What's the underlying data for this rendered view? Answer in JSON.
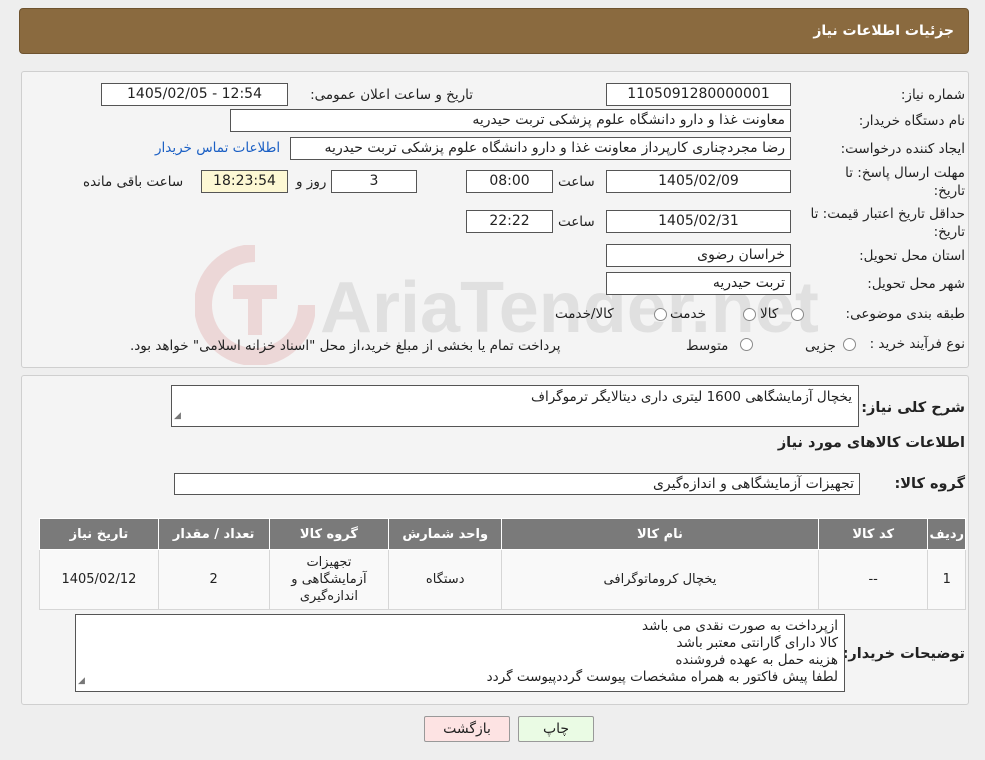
{
  "header": {
    "title": "جزئیات اطلاعات نیاز"
  },
  "watermark": {
    "text": "AriaTender.net"
  },
  "form": {
    "need_number_label": "شماره نیاز:",
    "need_number": "1105091280000001",
    "announce_label": "تاریخ و ساعت اعلان عمومی:",
    "announce_value": "1405/02/05 - 12:54",
    "buyer_org_label": "نام دستگاه خریدار:",
    "buyer_org": "معاونت غذا و دارو   دانشگاه علوم پزشکی تربت حیدریه",
    "creator_label": "ایجاد کننده درخواست:",
    "creator": "رضا مجردچناری کارپرداز معاونت غذا و دارو   دانشگاه علوم پزشکی تربت حیدریه",
    "contact_link": "اطلاعات تماس خریدار",
    "deadline_label_1": "مهلت ارسال پاسخ: تا",
    "deadline_label_2": "تاریخ:",
    "deadline_date": "1405/02/09",
    "time_label": "ساعت",
    "deadline_time": "08:00",
    "days_value": "3",
    "days_label": "روز و",
    "remaining_time": "18:23:54",
    "remaining_label": "ساعت باقی مانده",
    "validity_label_1": "حداقل تاریخ اعتبار قیمت: تا",
    "validity_label_2": "تاریخ:",
    "validity_date": "1405/02/31",
    "validity_time": "22:22",
    "province_label": "استان محل تحویل:",
    "province": "خراسان رضوی",
    "city_label": "شهر محل تحویل:",
    "city": "تربت حیدریه",
    "category_label": "طبقه بندی موضوعی:",
    "category_options": [
      "کالا",
      "خدمت",
      "کالا/خدمت"
    ],
    "process_label": "نوع فرآیند خرید :",
    "process_options": [
      "جزیی",
      "متوسط"
    ],
    "process_note": "پرداخت تمام یا بخشی از مبلغ خرید،از محل \"اسناد خزانه اسلامی\" خواهد بود."
  },
  "summary": {
    "label": "شرح کلی نیاز:",
    "value": "یخچال آزمایشگاهی 1600 لیتری داری دیتالایگر ترموگراف",
    "goods_info_title": "اطلاعات کالاهای مورد نیاز",
    "group_label": "گروه کالا:",
    "group_value": "تجهیزات آزمایشگاهی و اندازه‌گیری"
  },
  "table": {
    "headers": [
      "ردیف",
      "کد کالا",
      "نام کالا",
      "واحد شمارش",
      "گروه کالا",
      "تعداد / مقدار",
      "تاریخ نیاز"
    ],
    "rows": [
      [
        "1",
        "--",
        "یخچال کروماتوگرافی",
        "دستگاه",
        "تجهیزات آزمایشگاهی و اندازه‌گیری",
        "2",
        "1405/02/12"
      ]
    ]
  },
  "buyer_notes": {
    "label": "توضیحات خریدار:",
    "lines": [
      "ازپرداخت به صورت نقدی می باشد",
      "کالا دارای گارانتی معتبر باشد",
      "هزینه حمل به عهده فروشنده",
      "لطفا پیش فاکتور به همراه مشخصات پیوست گرددپیوست گردد"
    ]
  },
  "buttons": {
    "print": "چاپ",
    "back": "بازگشت"
  }
}
